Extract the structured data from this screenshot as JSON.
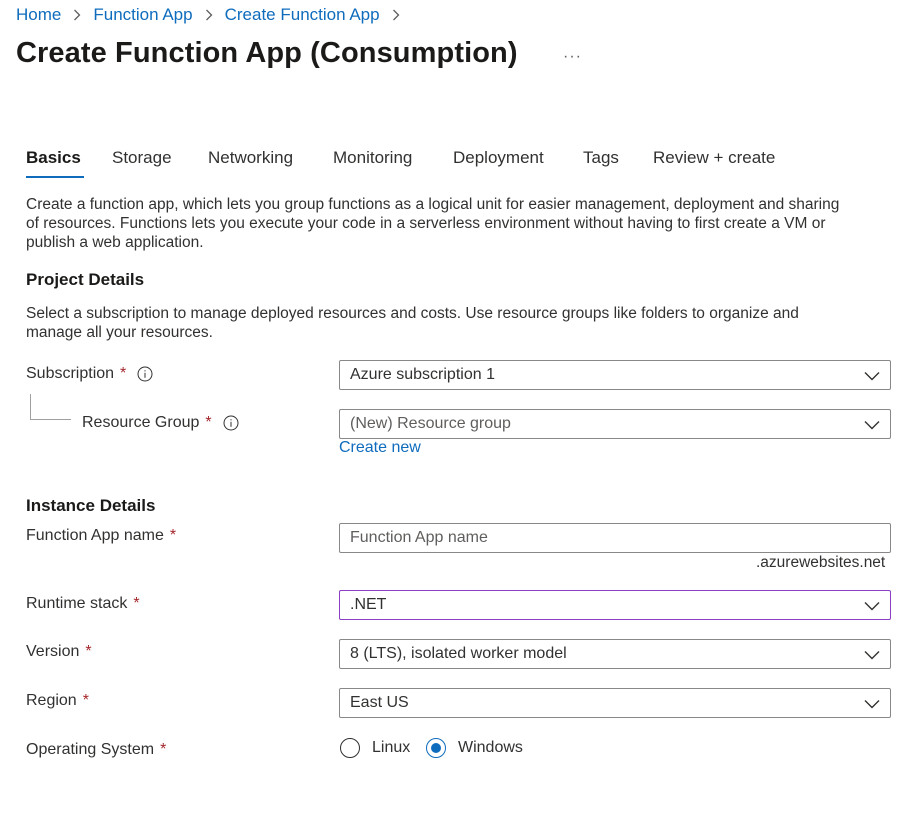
{
  "breadcrumb": {
    "items": [
      "Home",
      "Function App",
      "Create Function App"
    ]
  },
  "page": {
    "title": "Create Function App (Consumption)",
    "more_label": "···"
  },
  "tabs": [
    {
      "label": "Basics",
      "active": true
    },
    {
      "label": "Storage"
    },
    {
      "label": "Networking"
    },
    {
      "label": "Monitoring"
    },
    {
      "label": "Deployment"
    },
    {
      "label": "Tags"
    },
    {
      "label": "Review + create"
    }
  ],
  "intro": {
    "line1": "Create a function app, which lets you group functions as a logical unit for easier management, deployment and sharing",
    "line2": "of resources. Functions lets you execute your code in a serverless environment without having to first create a VM or",
    "line3": "publish a web application."
  },
  "project": {
    "heading": "Project Details",
    "desc_line1": "Select a subscription to manage deployed resources and costs. Use resource groups like folders to organize and",
    "desc_line2": "manage all your resources.",
    "subscription": {
      "label": "Subscription",
      "required": "*",
      "value": "Azure subscription 1"
    },
    "resource_group": {
      "label": "Resource Group",
      "required": "*",
      "value": "(New) Resource group",
      "create_new": "Create new"
    }
  },
  "instance": {
    "heading": "Instance Details",
    "app_name": {
      "label": "Function App name",
      "required": "*",
      "placeholder": "Function App name",
      "suffix": ".azurewebsites.net"
    },
    "runtime": {
      "label": "Runtime stack",
      "required": "*",
      "value": ".NET"
    },
    "version": {
      "label": "Version",
      "required": "*",
      "value": "8 (LTS), isolated worker model"
    },
    "region": {
      "label": "Region",
      "required": "*",
      "value": "East US"
    },
    "os": {
      "label": "Operating System",
      "required": "*",
      "options": [
        "Linux",
        "Windows"
      ],
      "selected": "Windows"
    }
  },
  "colors": {
    "accent": "#0f6cbd",
    "required": "#a4262c",
    "focus_border": "#8a3fc4"
  },
  "icons": [
    "chevron-right-icon",
    "info-icon",
    "chevron-down-icon"
  ]
}
